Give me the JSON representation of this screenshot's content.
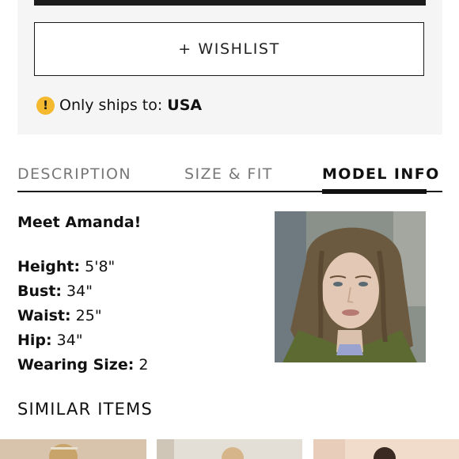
{
  "product": {
    "wishlist_label": "+ WISHLIST",
    "ships_label": "Only ships to:",
    "ships_country": "USA"
  },
  "tabs": [
    {
      "label": "DESCRIPTION",
      "active": false
    },
    {
      "label": "SIZE & FIT",
      "active": false
    },
    {
      "label": "MODEL INFO",
      "active": true
    }
  ],
  "model": {
    "intro": "Meet Amanda!",
    "stats": [
      {
        "label": "Height:",
        "value": "5'8\""
      },
      {
        "label": "Bust:",
        "value": "34\""
      },
      {
        "label": "Waist:",
        "value": "25\""
      },
      {
        "label": "Hip:",
        "value": "34\""
      },
      {
        "label": "Wearing Size:",
        "value": "2"
      }
    ]
  },
  "similar": {
    "title": "SIMILAR ITEMS"
  },
  "colors": {
    "panel_bg": "#f5f5f5",
    "warning": "#f4b92e",
    "text": "#111111",
    "muted": "#777777"
  }
}
